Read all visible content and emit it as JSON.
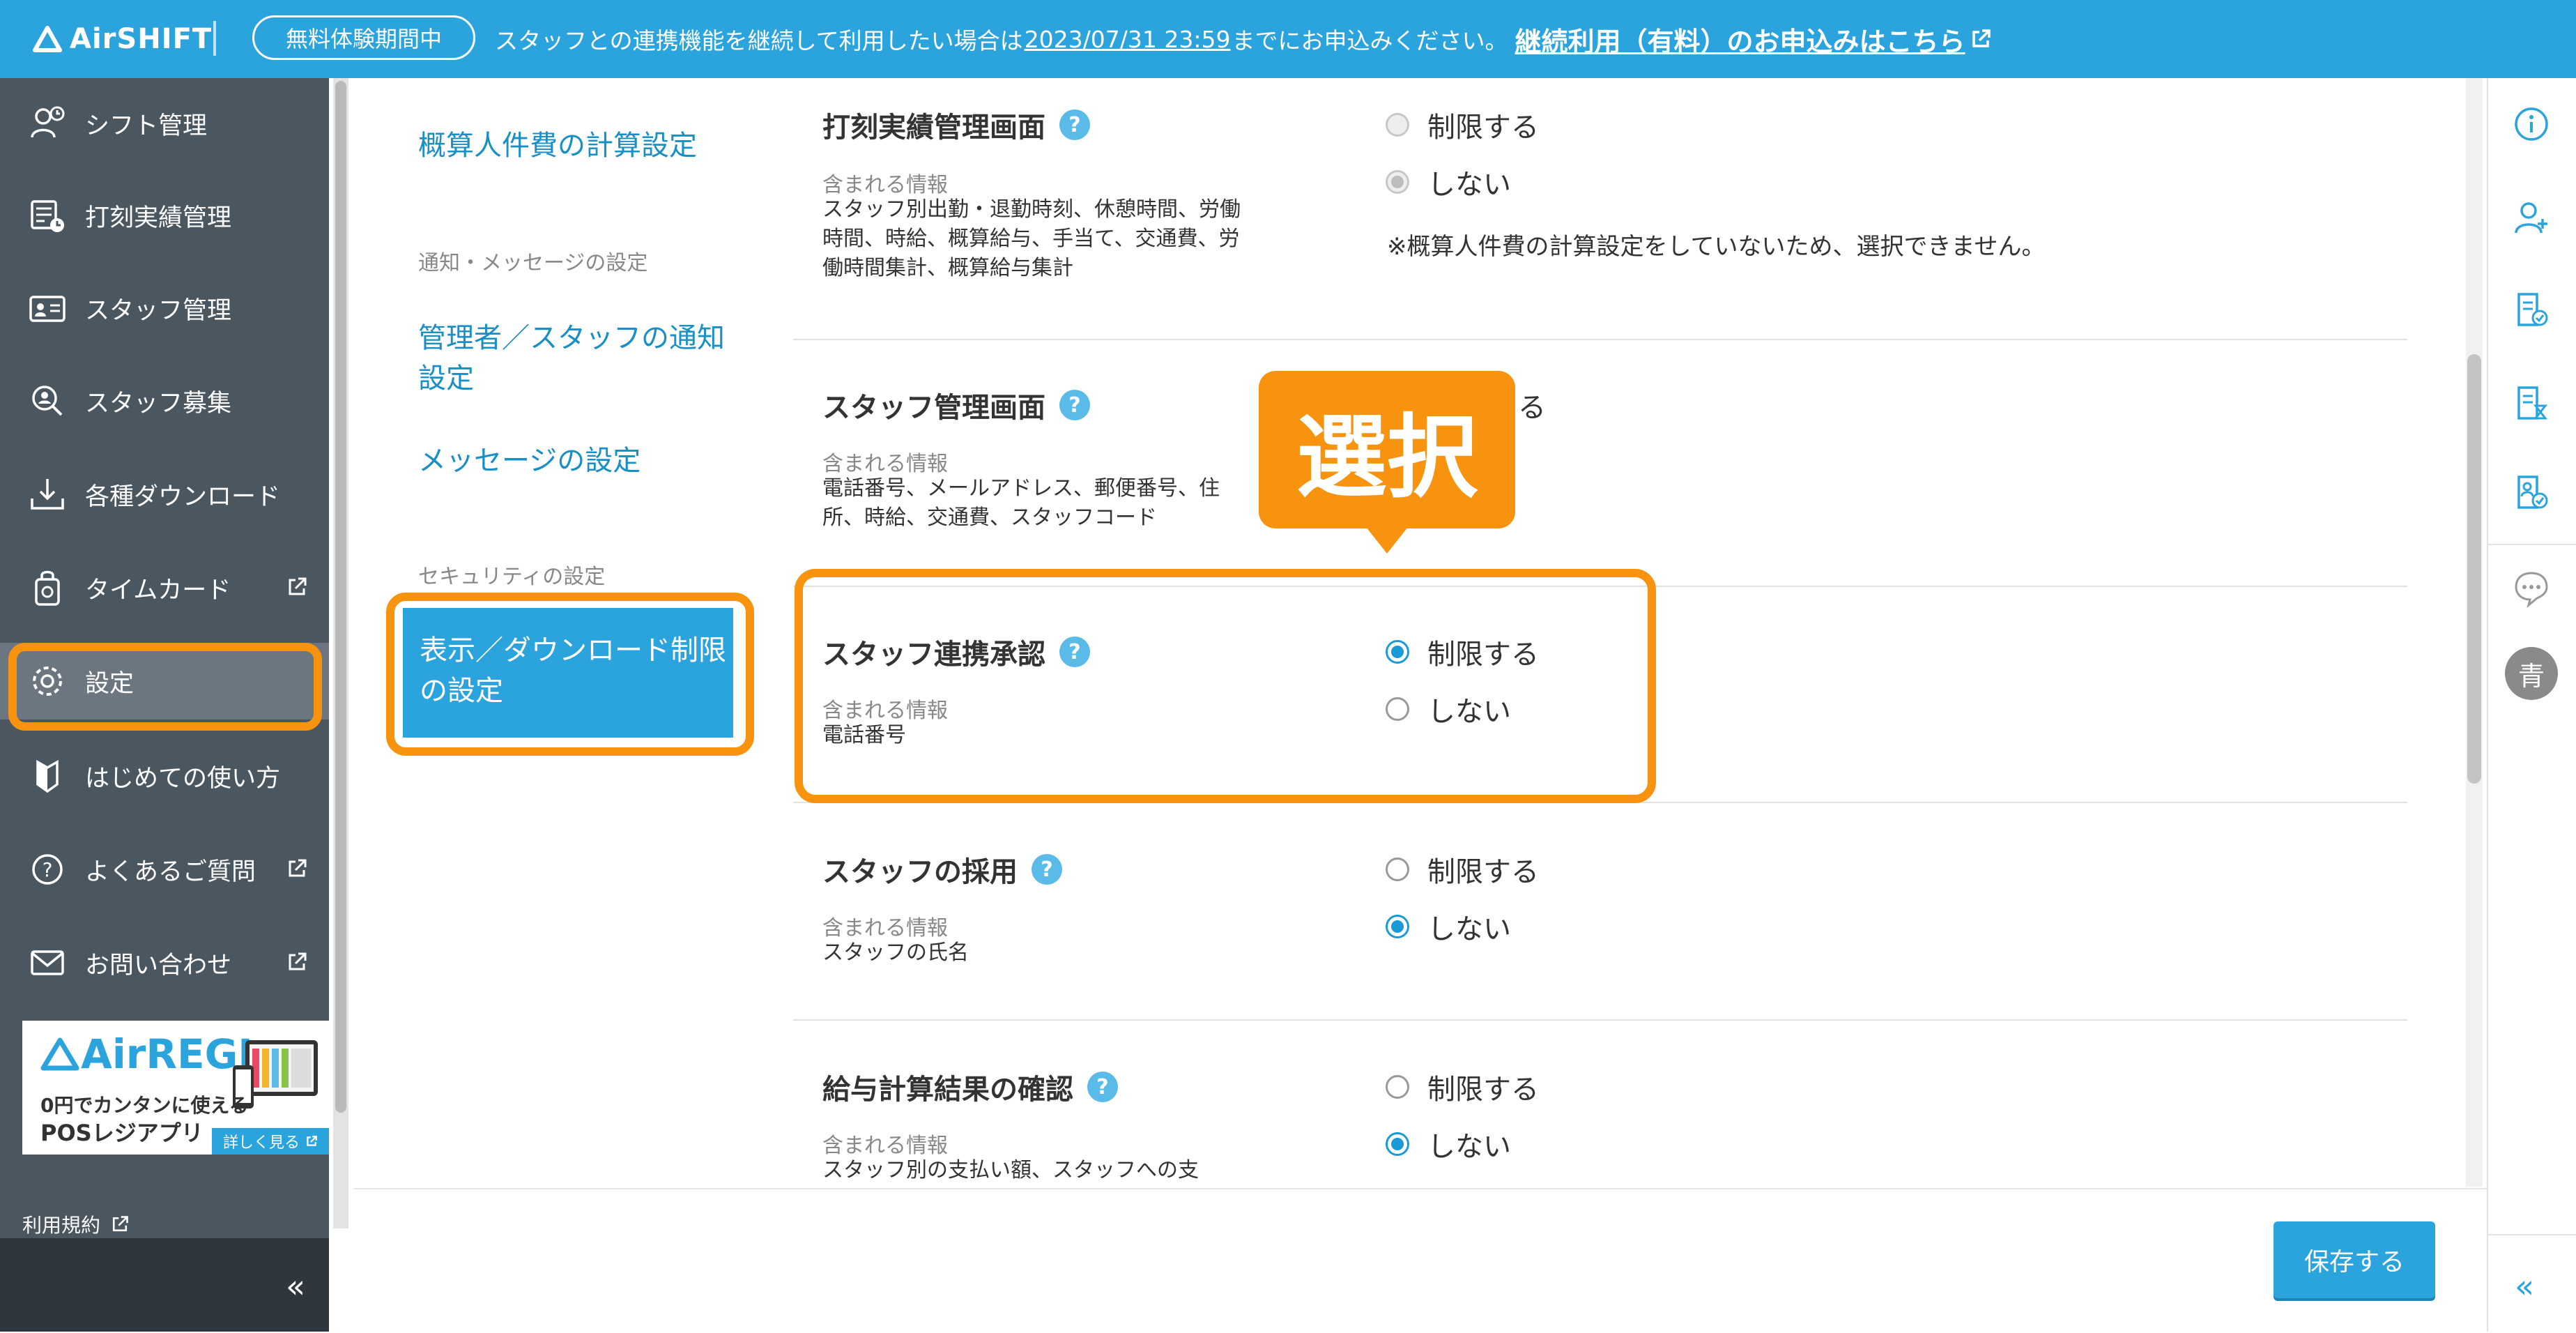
{
  "banner": {
    "logo_text": "AirSHIFT",
    "trial_badge": "無料体験期間中",
    "notice_prefix": "スタッフとの連携機能を継続して利用したい場合は",
    "notice_deadline": "2023/07/31 23:59",
    "notice_suffix": "までにお申込みください。",
    "notice_link": "継続利用（有料）のお申込みはこちら"
  },
  "sidebar": {
    "items": [
      {
        "label": "シフト管理",
        "icon": "shift-icon"
      },
      {
        "label": "打刻実績管理",
        "icon": "timestamp-icon"
      },
      {
        "label": "スタッフ管理",
        "icon": "staff-card-icon"
      },
      {
        "label": "スタッフ募集",
        "icon": "recruit-icon"
      },
      {
        "label": "各種ダウンロード",
        "icon": "download-icon"
      },
      {
        "label": "タイムカード",
        "icon": "timecard-icon"
      },
      {
        "label": "設定",
        "icon": "gear-icon"
      },
      {
        "label": "はじめての使い方",
        "icon": "beginner-icon"
      },
      {
        "label": "よくあるご質問",
        "icon": "question-icon"
      },
      {
        "label": "お問い合わせ",
        "icon": "mail-icon"
      }
    ],
    "ad": {
      "logo": "AirREGI",
      "line1": "0円でカンタンに使える",
      "line2": "POSレジアプリ",
      "more": "詳しく見る"
    },
    "terms": "利用規約",
    "collapse": "«"
  },
  "subnav": {
    "link_cost": "概算人件費の計算設定",
    "head_notify": "通知・メッセージの設定",
    "link_notify": "管理者／スタッフの通知設定",
    "link_message": "メッセージの設定",
    "head_security": "セキュリティの設定",
    "active": "表示／ダウンロード制限の設定"
  },
  "rows": [
    {
      "title": "打刻実績管理画面",
      "sub": "含まれる情報",
      "info": "スタッフ別出勤・退勤時刻、休憩時間、労働時間、時給、概算給与、手当て、交通費、労働時間集計、概算給与集計",
      "opt1": "制限する",
      "opt2": "しない",
      "note": "※概算人件費の計算設定をしていないため、選択できません。"
    },
    {
      "title": "スタッフ管理画面",
      "sub": "含まれる情報",
      "info": "電話番号、メールアドレス、郵便番号、住所、時給、交通費、スタッフコード",
      "opt1": "る"
    },
    {
      "title": "スタッフ連携承認",
      "sub": "含まれる情報",
      "info": "電話番号",
      "opt1": "制限する",
      "opt2": "しない"
    },
    {
      "title": "スタッフの採用",
      "sub": "含まれる情報",
      "info": "スタッフの氏名",
      "opt1": "制限する",
      "opt2": "しない"
    },
    {
      "title": "給与計算結果の確認",
      "sub": "含まれる情報",
      "info": "スタッフ別の支払い額、スタッフへの支",
      "opt1": "制限する",
      "opt2": "しない"
    }
  ],
  "callout": "選択",
  "help_glyph": "?",
  "save_label": "保存する",
  "rightbar": {
    "avatar": "青",
    "collapse": "«"
  },
  "colors": {
    "brand": "#2ba3dd",
    "sidebar": "#4a5761",
    "highlight": "#f7930e"
  }
}
